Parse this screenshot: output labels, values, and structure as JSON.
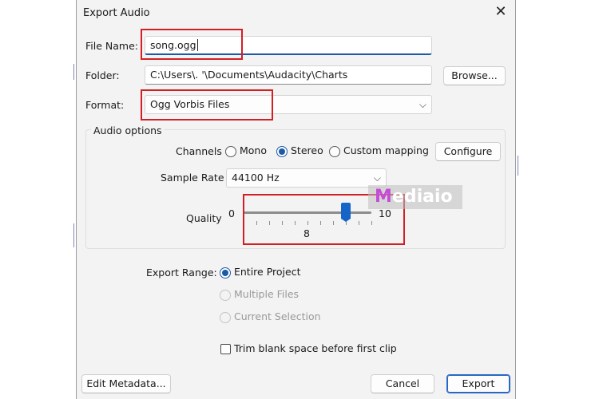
{
  "dialog": {
    "title": "Export Audio"
  },
  "file_name": {
    "label": "File Name:",
    "value": "song.ogg"
  },
  "folder": {
    "label": "Folder:",
    "value": "C:\\Users\\.       '\\Documents\\Audacity\\Charts",
    "browse_label": "Browse..."
  },
  "format": {
    "label": "Format:",
    "value": "Ogg Vorbis Files"
  },
  "audio_options": {
    "title": "Audio options",
    "channels": {
      "label": "Channels",
      "options": [
        {
          "label": "Mono",
          "selected": false
        },
        {
          "label": "Stereo",
          "selected": true
        },
        {
          "label": "Custom mapping",
          "selected": false
        }
      ],
      "configure_label": "Configure"
    },
    "sample_rate": {
      "label": "Sample Rate",
      "value": "44100 Hz"
    },
    "quality": {
      "label": "Quality",
      "min_label": "0",
      "max_label": "10",
      "value_label": "8",
      "value": 8,
      "min": 0,
      "max": 10
    }
  },
  "export_range": {
    "label": "Export Range:",
    "options": [
      {
        "label": "Entire Project",
        "selected": true,
        "enabled": true
      },
      {
        "label": "Multiple Files",
        "selected": false,
        "enabled": false
      },
      {
        "label": "Current Selection",
        "selected": false,
        "enabled": false
      }
    ]
  },
  "trim": {
    "label": "Trim blank space before first clip",
    "checked": false
  },
  "buttons": {
    "edit_metadata": "Edit Metadata...",
    "cancel": "Cancel",
    "export": "Export"
  },
  "watermark": {
    "first": "M",
    "rest": "ediaio"
  },
  "colors": {
    "accent": "#1c5aa8",
    "highlight": "#d11f24"
  },
  "icons": {
    "close": "close-icon",
    "dropdown": "chevron-down-icon"
  }
}
